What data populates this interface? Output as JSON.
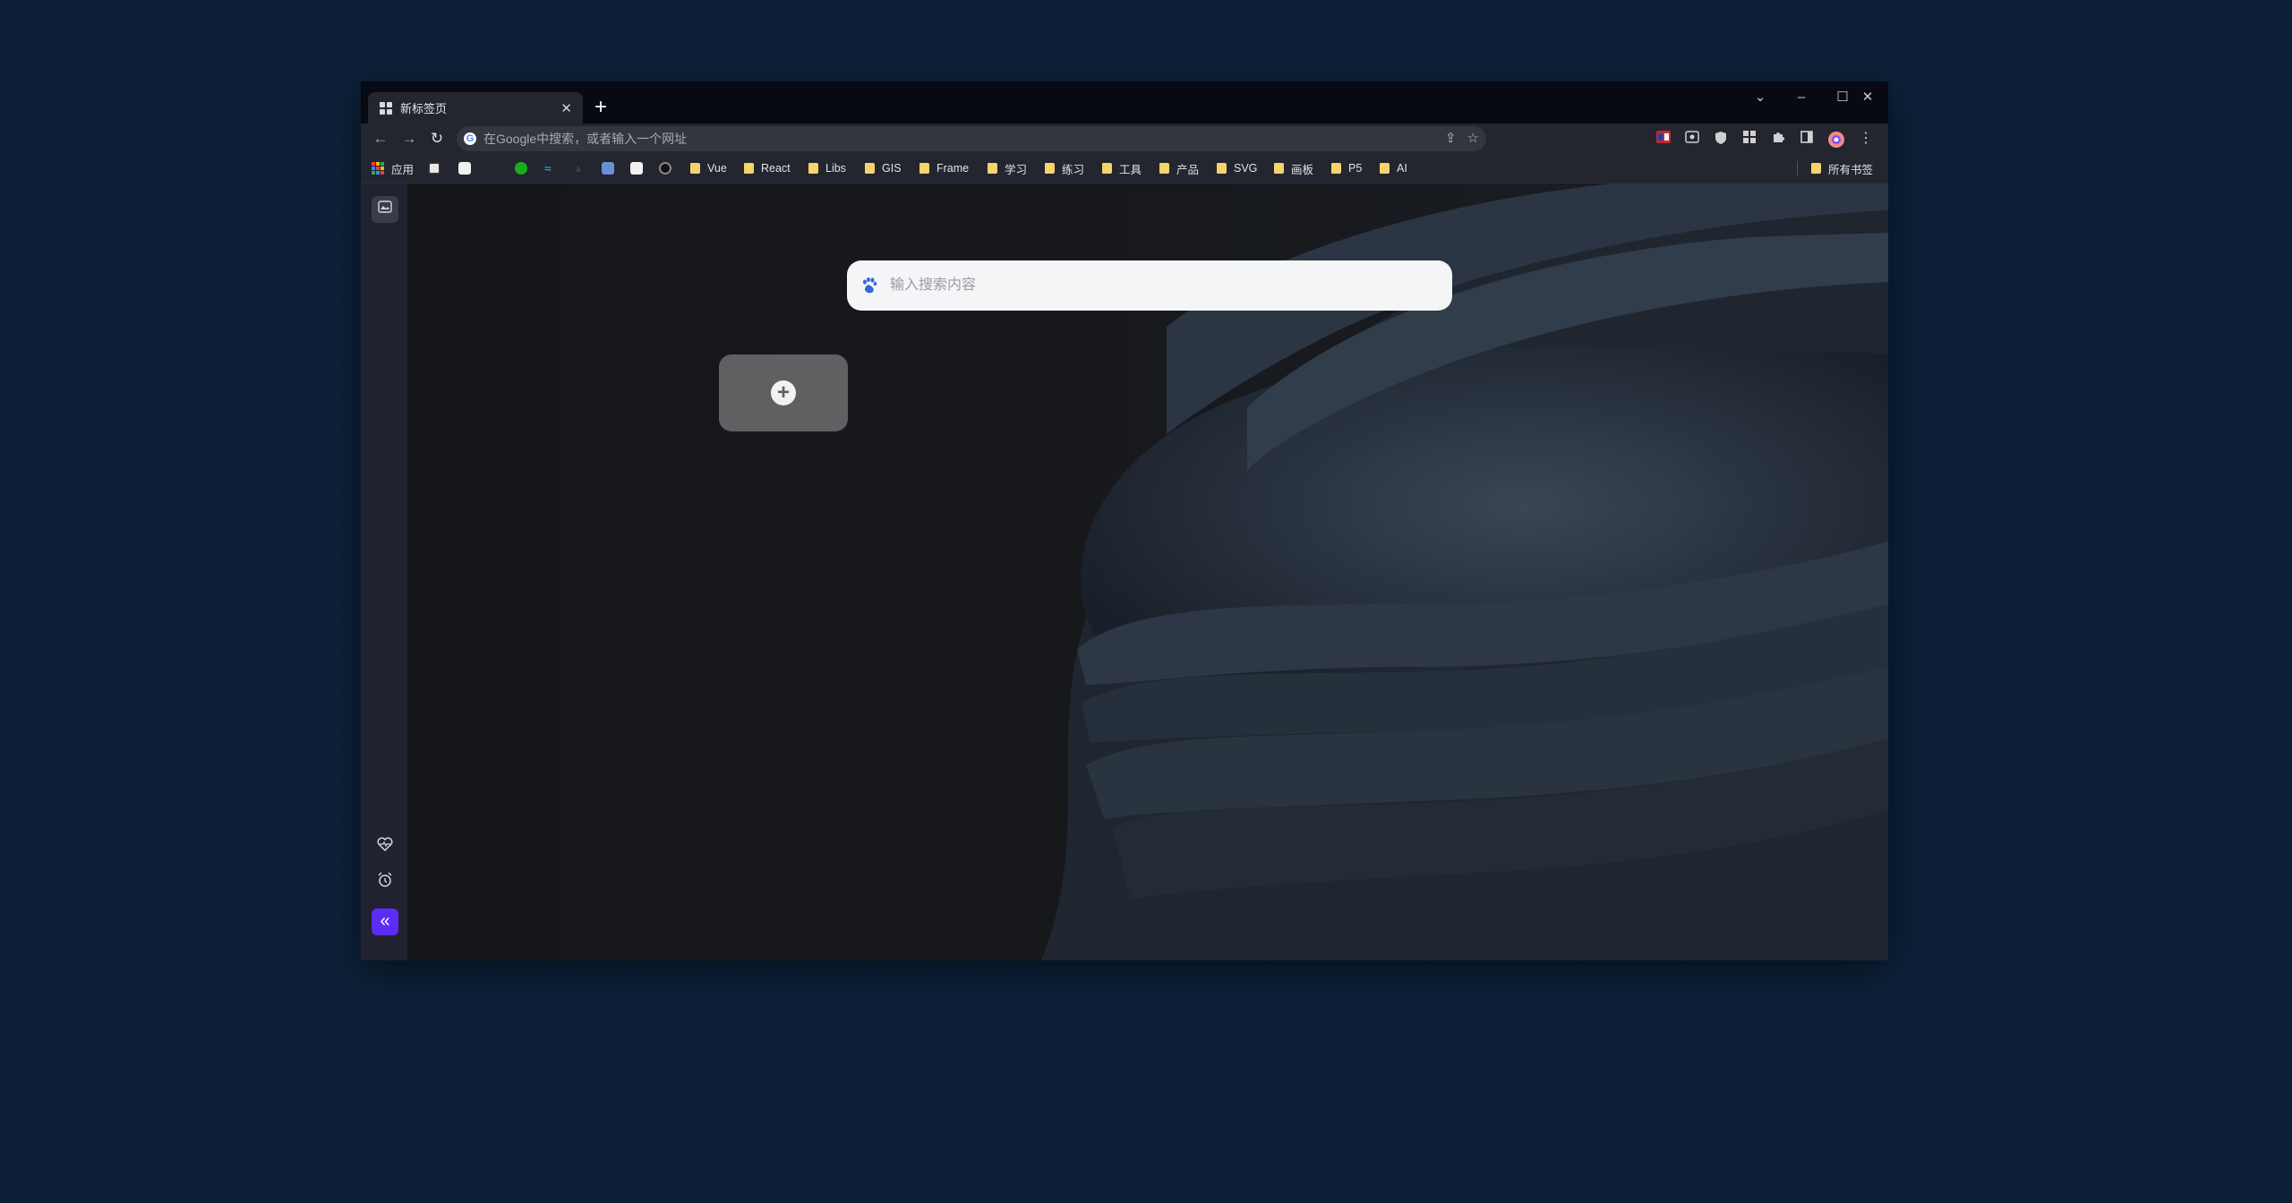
{
  "tab": {
    "title": "新标签页",
    "close_icon": "close-icon"
  },
  "window_controls": {
    "tab_search": "⌄",
    "minimize": "–",
    "maximize": "☐",
    "close": "✕"
  },
  "toolbar": {
    "back": "←",
    "forward": "→",
    "reload": "↻",
    "omnibox_placeholder": "在Google中搜索，或者输入一个网址",
    "share": "⇪",
    "star": "☆"
  },
  "bookmarks": {
    "apps_label": "应用",
    "folders": [
      "Vue",
      "React",
      "Libs",
      "GIS",
      "Frame",
      "学习",
      "练习",
      "工具",
      "产品",
      "SVG",
      "画板",
      "P5",
      "AI"
    ],
    "all_bookmarks": "所有书签"
  },
  "newtab": {
    "search_placeholder": "输入搜索内容",
    "add_shortcut": "+"
  },
  "sidebar": {
    "top_icon": "wallpaper-icon",
    "heart_icon": "heart-pulse-icon",
    "alarm_icon": "alarm-clock-icon",
    "collapse_icon": "«"
  },
  "colors": {
    "desktop": "#0b2038",
    "accent_collapse": "#5b2cf5",
    "bookmark_folder": "#f6d36b"
  }
}
